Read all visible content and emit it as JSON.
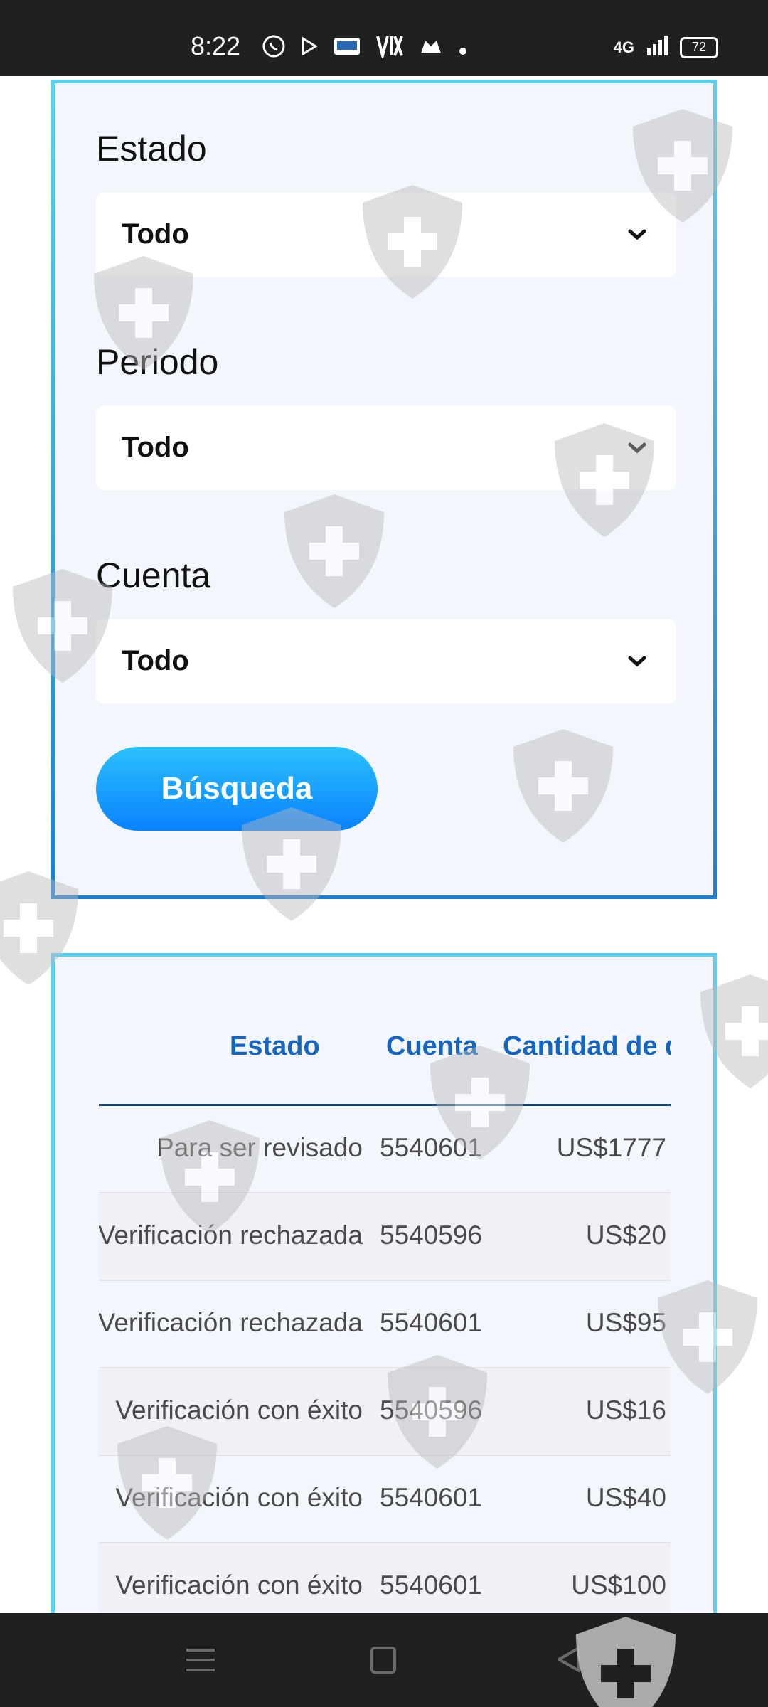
{
  "status_bar": {
    "time": "8:22",
    "icons": [
      "whatsapp-icon",
      "play-icon",
      "sdr-icon",
      "vix-icon",
      "game-icon",
      "dot-icon"
    ],
    "network": "4G",
    "battery": "72"
  },
  "filters": {
    "estado": {
      "label": "Estado",
      "value": "Todo"
    },
    "periodo": {
      "label": "Periodo",
      "value": "Todo"
    },
    "cuenta": {
      "label": "Cuenta",
      "value": "Todo"
    },
    "search_button": "Búsqueda"
  },
  "table": {
    "headers": [
      "Estado",
      "Cuenta",
      "Cantidad de d"
    ],
    "rows": [
      {
        "estado": "Para ser revisado",
        "cuenta": "5540601",
        "cantidad": "US$1777"
      },
      {
        "estado": "Verificación rechazada",
        "cuenta": "5540596",
        "cantidad": "US$20"
      },
      {
        "estado": "Verificación rechazada",
        "cuenta": "5540601",
        "cantidad": "US$95"
      },
      {
        "estado": "Verificación con éxito",
        "cuenta": "5540596",
        "cantidad": "US$16"
      },
      {
        "estado": "Verificación con éxito",
        "cuenta": "5540601",
        "cantidad": "US$40"
      },
      {
        "estado": "Verificación con éxito",
        "cuenta": "5540601",
        "cantidad": "US$100"
      }
    ]
  },
  "nav_bar": {
    "icons": [
      "menu-icon",
      "home-icon",
      "back-icon"
    ]
  },
  "colors": {
    "accent": "#1b9cf5",
    "header_text": "#1565c0",
    "card_bg": "#f3f6fd",
    "border": "#5cd0f0"
  }
}
